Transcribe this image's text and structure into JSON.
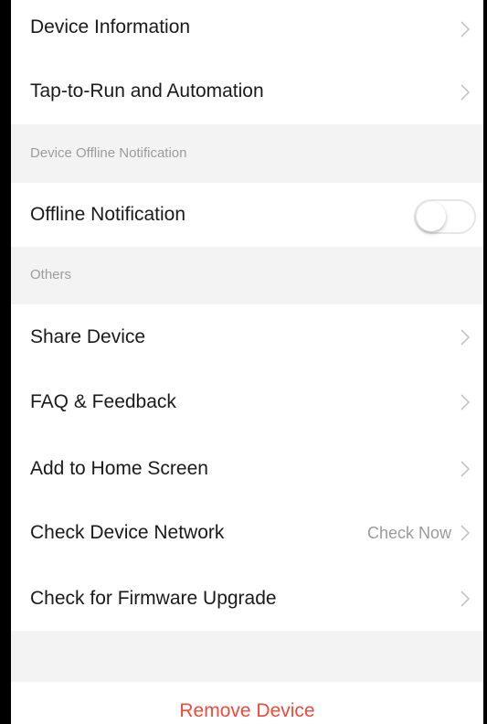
{
  "menu": {
    "device_information": "Device Information",
    "tap_to_run": "Tap-to-Run and Automation"
  },
  "offline_section": {
    "header": "Device Offline Notification",
    "offline_notification_label": "Offline Notification",
    "offline_notification_enabled": false
  },
  "others_section": {
    "header": "Others",
    "share_device": "Share Device",
    "faq_feedback": "FAQ & Feedback",
    "add_to_home_screen": "Add to Home Screen",
    "check_device_network": "Check Device Network",
    "check_device_network_detail": "Check Now",
    "check_firmware_upgrade": "Check for Firmware Upgrade"
  },
  "remove_device": "Remove Device",
  "colors": {
    "background": "#f3f3f3",
    "row_background": "#ffffff",
    "destructive": "#f04a3a",
    "secondary_text": "#9a9a9a"
  },
  "icons": {
    "chevron": "chevron-right-icon"
  }
}
